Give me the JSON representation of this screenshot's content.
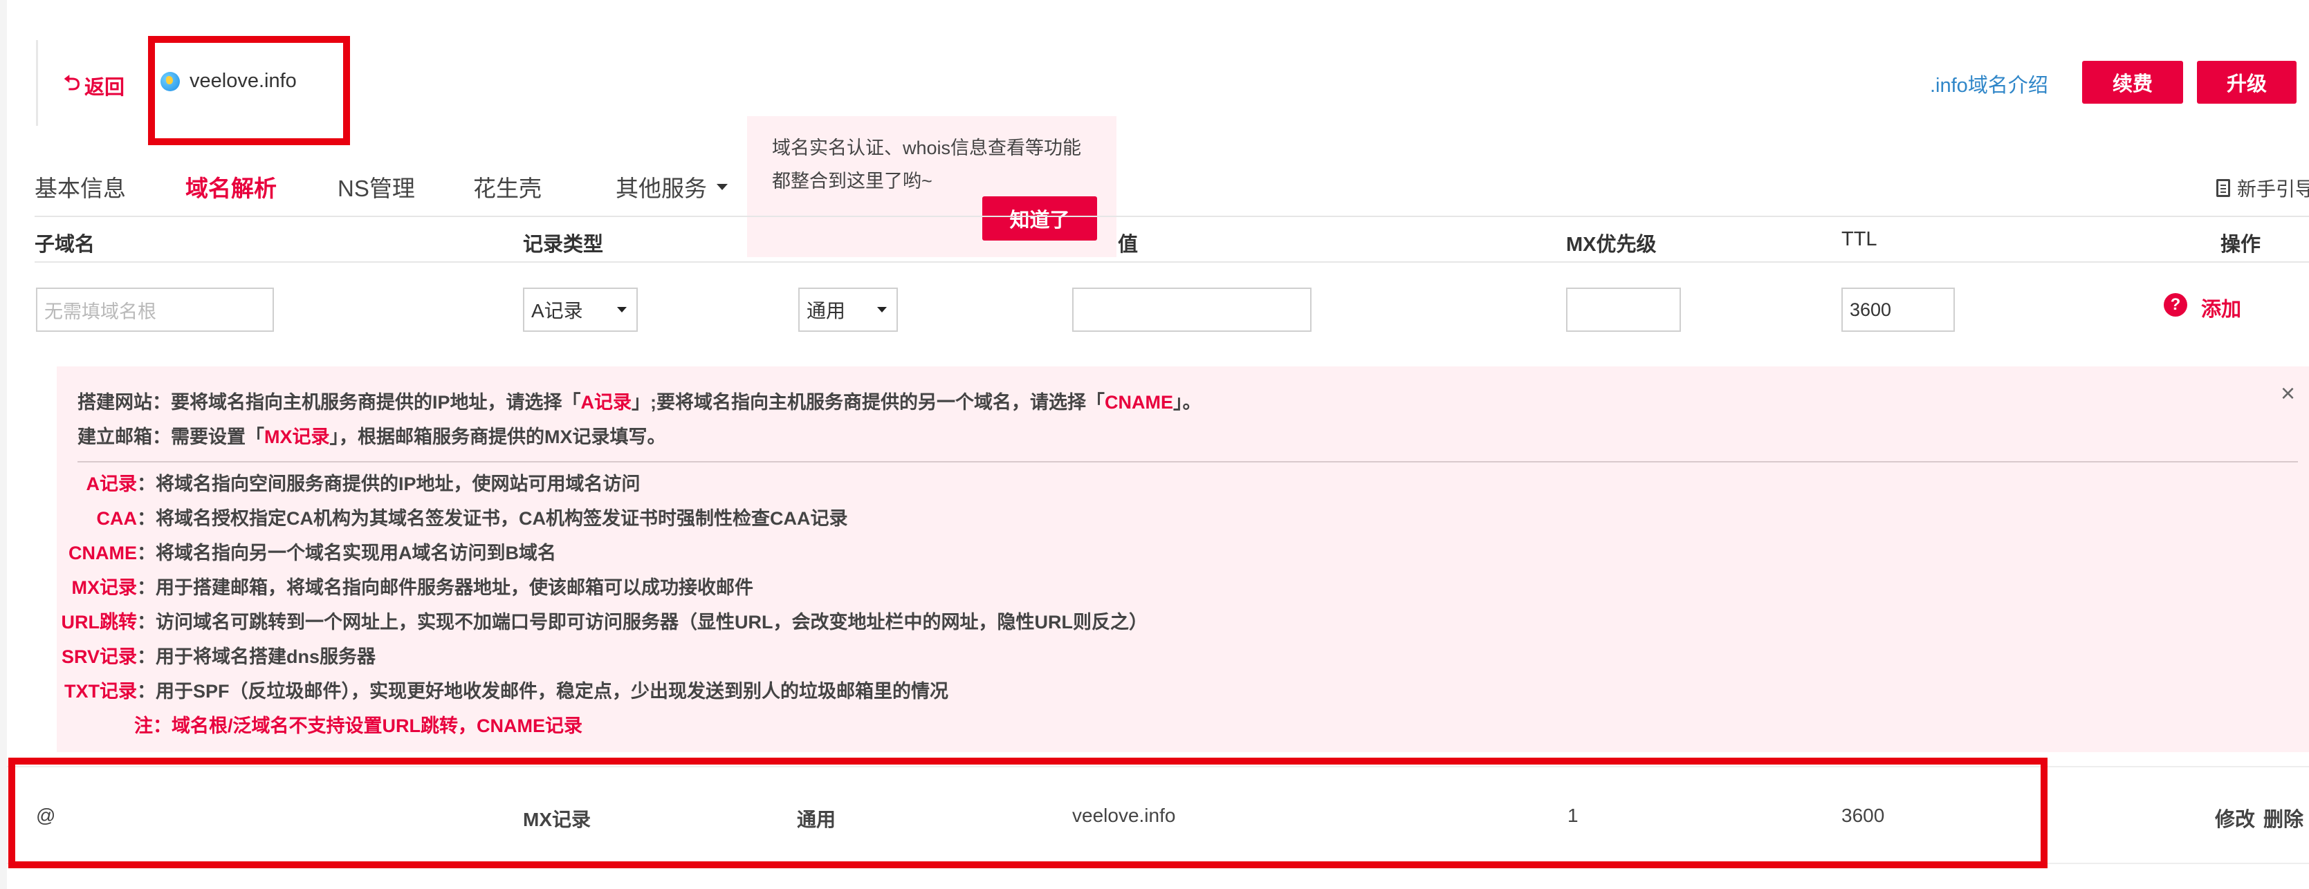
{
  "header": {
    "back_label": "返回",
    "domain": "veelove.info",
    "info_link": ".info域名介绍",
    "renew_label": "续费",
    "upgrade_label": "升级"
  },
  "tabs": [
    {
      "label": "基本信息",
      "active": false
    },
    {
      "label": "域名解析",
      "active": true
    },
    {
      "label": "NS管理",
      "active": false
    },
    {
      "label": "花生壳",
      "active": false
    },
    {
      "label": "其他服务",
      "active": false
    }
  ],
  "popover": {
    "line1": "域名实名认证、whois信息查看等功能",
    "line2": "都整合到这里了哟~",
    "button": "知道了"
  },
  "guide_label": "新手引导",
  "table": {
    "headers": {
      "subdomain": "子域名",
      "record_type": "记录类型",
      "value": "值",
      "mx": "MX优先级",
      "ttl": "TTL",
      "ops": "操作"
    }
  },
  "form": {
    "subdomain_placeholder": "无需填域名根",
    "record_type": "A记录",
    "line": "通用",
    "value": "",
    "mx": "",
    "ttl": "3600",
    "help_icon": "?",
    "add_label": "添加"
  },
  "tips": {
    "l1_a": "搭建网站：要将域名指向主机服务商提供的IP地址，请选择「",
    "l1_b": "A记录",
    "l1_c": "」;要将域名指向主机服务商提供的另一个域名，请选择「",
    "l1_d": "CNAME",
    "l1_e": "」。",
    "l2_a": "建立邮箱：需要设置「",
    "l2_b": "MX记录",
    "l2_c": "」，根据邮箱服务商提供的MX记录填写。",
    "close_icon": "×",
    "defs": [
      {
        "term": "A记录",
        "desc": "：将域名指向空间服务商提供的IP地址，使网站可用域名访问"
      },
      {
        "term": "CAA",
        "desc": "：将域名授权指定CA机构为其域名签发证书，CA机构签发证书时强制性检查CAA记录"
      },
      {
        "term": "CNAME",
        "desc": "：将域名指向另一个域名实现用A域名访问到B域名"
      },
      {
        "term": "MX记录",
        "desc": "：用于搭建邮箱，将域名指向邮件服务器地址，使该邮箱可以成功接收邮件"
      },
      {
        "term": "URL跳转",
        "desc": "：访问域名可跳转到一个网址上，实现不加端口号即可访问服务器（显性URL，会改变地址栏中的网址，隐性URL则反之）"
      },
      {
        "term": "SRV记录",
        "desc": "：用于将域名搭建dns服务器"
      },
      {
        "term": "TXT记录",
        "desc": "：用于SPF（反垃圾邮件），实现更好地收发邮件，稳定点，少出现发送到别人的垃圾邮箱里的情况"
      }
    ],
    "note": "注：域名根/泛域名不支持设置URL跳转，CNAME记录"
  },
  "records": [
    {
      "subdomain": "@",
      "type": "MX记录",
      "line": "通用",
      "value": "veelove.info",
      "mx": "1",
      "ttl": "3600",
      "edit": "修改",
      "delete": "删除"
    }
  ]
}
